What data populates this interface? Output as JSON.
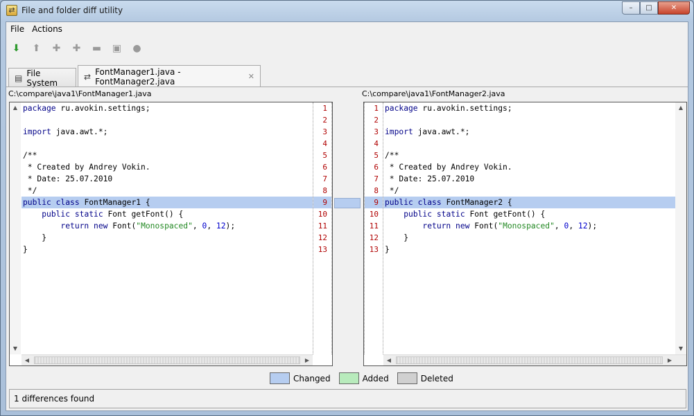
{
  "window": {
    "title": "File and folder diff utility",
    "minimize": "–",
    "maximize": "□",
    "close": "✕"
  },
  "menu": [
    "File",
    "Actions"
  ],
  "toolbar": [
    {
      "name": "next-diff-icon",
      "glyph": "⬇"
    },
    {
      "name": "prev-diff-icon",
      "glyph": "⬆"
    },
    {
      "name": "copy-right-icon",
      "glyph": "✚"
    },
    {
      "name": "copy-left-icon",
      "glyph": "✚"
    },
    {
      "name": "delete-icon",
      "glyph": "▬"
    },
    {
      "name": "compare-icon",
      "glyph": "▣"
    },
    {
      "name": "stop-icon",
      "glyph": "●"
    }
  ],
  "tabs": [
    {
      "label": "File System",
      "icon": "file-system-icon"
    },
    {
      "label": "FontManager1.java - FontManager2.java",
      "icon": "compare-icon",
      "close": "✕"
    }
  ],
  "left": {
    "path": "C:\\compare\\java1\\FontManager1.java",
    "lines": [
      [
        {
          "t": "package",
          "c": "kw"
        },
        {
          "t": " ru.avokin.settings;"
        }
      ],
      [],
      [
        {
          "t": "import",
          "c": "kw"
        },
        {
          "t": " java.awt.*;"
        }
      ],
      [],
      [
        {
          "t": "/**"
        }
      ],
      [
        {
          "t": " * Created by Andrey Vokin."
        }
      ],
      [
        {
          "t": " * Date: 25.07.2010"
        }
      ],
      [
        {
          "t": " */"
        }
      ],
      [
        {
          "t": "public",
          "c": "kw"
        },
        {
          "t": " "
        },
        {
          "t": "class",
          "c": "kw"
        },
        {
          "t": " FontManager1 {"
        }
      ],
      [
        {
          "t": "    "
        },
        {
          "t": "public",
          "c": "kw"
        },
        {
          "t": " "
        },
        {
          "t": "static",
          "c": "kw"
        },
        {
          "t": " Font getFont() {"
        }
      ],
      [
        {
          "t": "        "
        },
        {
          "t": "return",
          "c": "kw"
        },
        {
          "t": " "
        },
        {
          "t": "new",
          "c": "kw"
        },
        {
          "t": " Font("
        },
        {
          "t": "\"Monospaced\"",
          "c": "str"
        },
        {
          "t": ", "
        },
        {
          "t": "0",
          "c": "num"
        },
        {
          "t": ", "
        },
        {
          "t": "12",
          "c": "num"
        },
        {
          "t": ");"
        }
      ],
      [
        {
          "t": "    }"
        }
      ],
      [
        {
          "t": "}"
        }
      ]
    ],
    "numbers": [
      "1",
      "2",
      "3",
      "4",
      "5",
      "6",
      "7",
      "8",
      "9",
      "10",
      "11",
      "12",
      "13"
    ]
  },
  "right": {
    "path": "C:\\compare\\java1\\FontManager2.java",
    "lines": [
      [
        {
          "t": "package",
          "c": "kw"
        },
        {
          "t": " ru.avokin.settings;"
        }
      ],
      [],
      [
        {
          "t": "import",
          "c": "kw"
        },
        {
          "t": " java.awt.*;"
        }
      ],
      [],
      [
        {
          "t": "/**"
        }
      ],
      [
        {
          "t": " * Created by Andrey Vokin."
        }
      ],
      [
        {
          "t": " * Date: 25.07.2010"
        }
      ],
      [
        {
          "t": " */"
        }
      ],
      [
        {
          "t": "public",
          "c": "kw"
        },
        {
          "t": " "
        },
        {
          "t": "class",
          "c": "kw"
        },
        {
          "t": " FontManager2 {"
        }
      ],
      [
        {
          "t": "    "
        },
        {
          "t": "public",
          "c": "kw"
        },
        {
          "t": " "
        },
        {
          "t": "static",
          "c": "kw"
        },
        {
          "t": " Font getFont() {"
        }
      ],
      [
        {
          "t": "        "
        },
        {
          "t": "return",
          "c": "kw"
        },
        {
          "t": " "
        },
        {
          "t": "new",
          "c": "kw"
        },
        {
          "t": " Font("
        },
        {
          "t": "\"Monospaced\"",
          "c": "str"
        },
        {
          "t": ", "
        },
        {
          "t": "0",
          "c": "num"
        },
        {
          "t": ", "
        },
        {
          "t": "12",
          "c": "num"
        },
        {
          "t": ");"
        }
      ],
      [
        {
          "t": "    }"
        }
      ],
      [
        {
          "t": "}"
        }
      ]
    ],
    "numbers": [
      "1",
      "2",
      "3",
      "4",
      "5",
      "6",
      "7",
      "8",
      "9",
      "10",
      "11",
      "12",
      "13"
    ]
  },
  "changed_line": 9,
  "legend": [
    {
      "label": "Changed",
      "color": "#b6cdf0"
    },
    {
      "label": "Added",
      "color": "#b8ebbc"
    },
    {
      "label": "Deleted",
      "color": "#d0d0d0"
    }
  ],
  "status": "1 differences found",
  "scroll": {
    "up": "▲",
    "down": "▼",
    "left": "◀",
    "right": "▶"
  }
}
